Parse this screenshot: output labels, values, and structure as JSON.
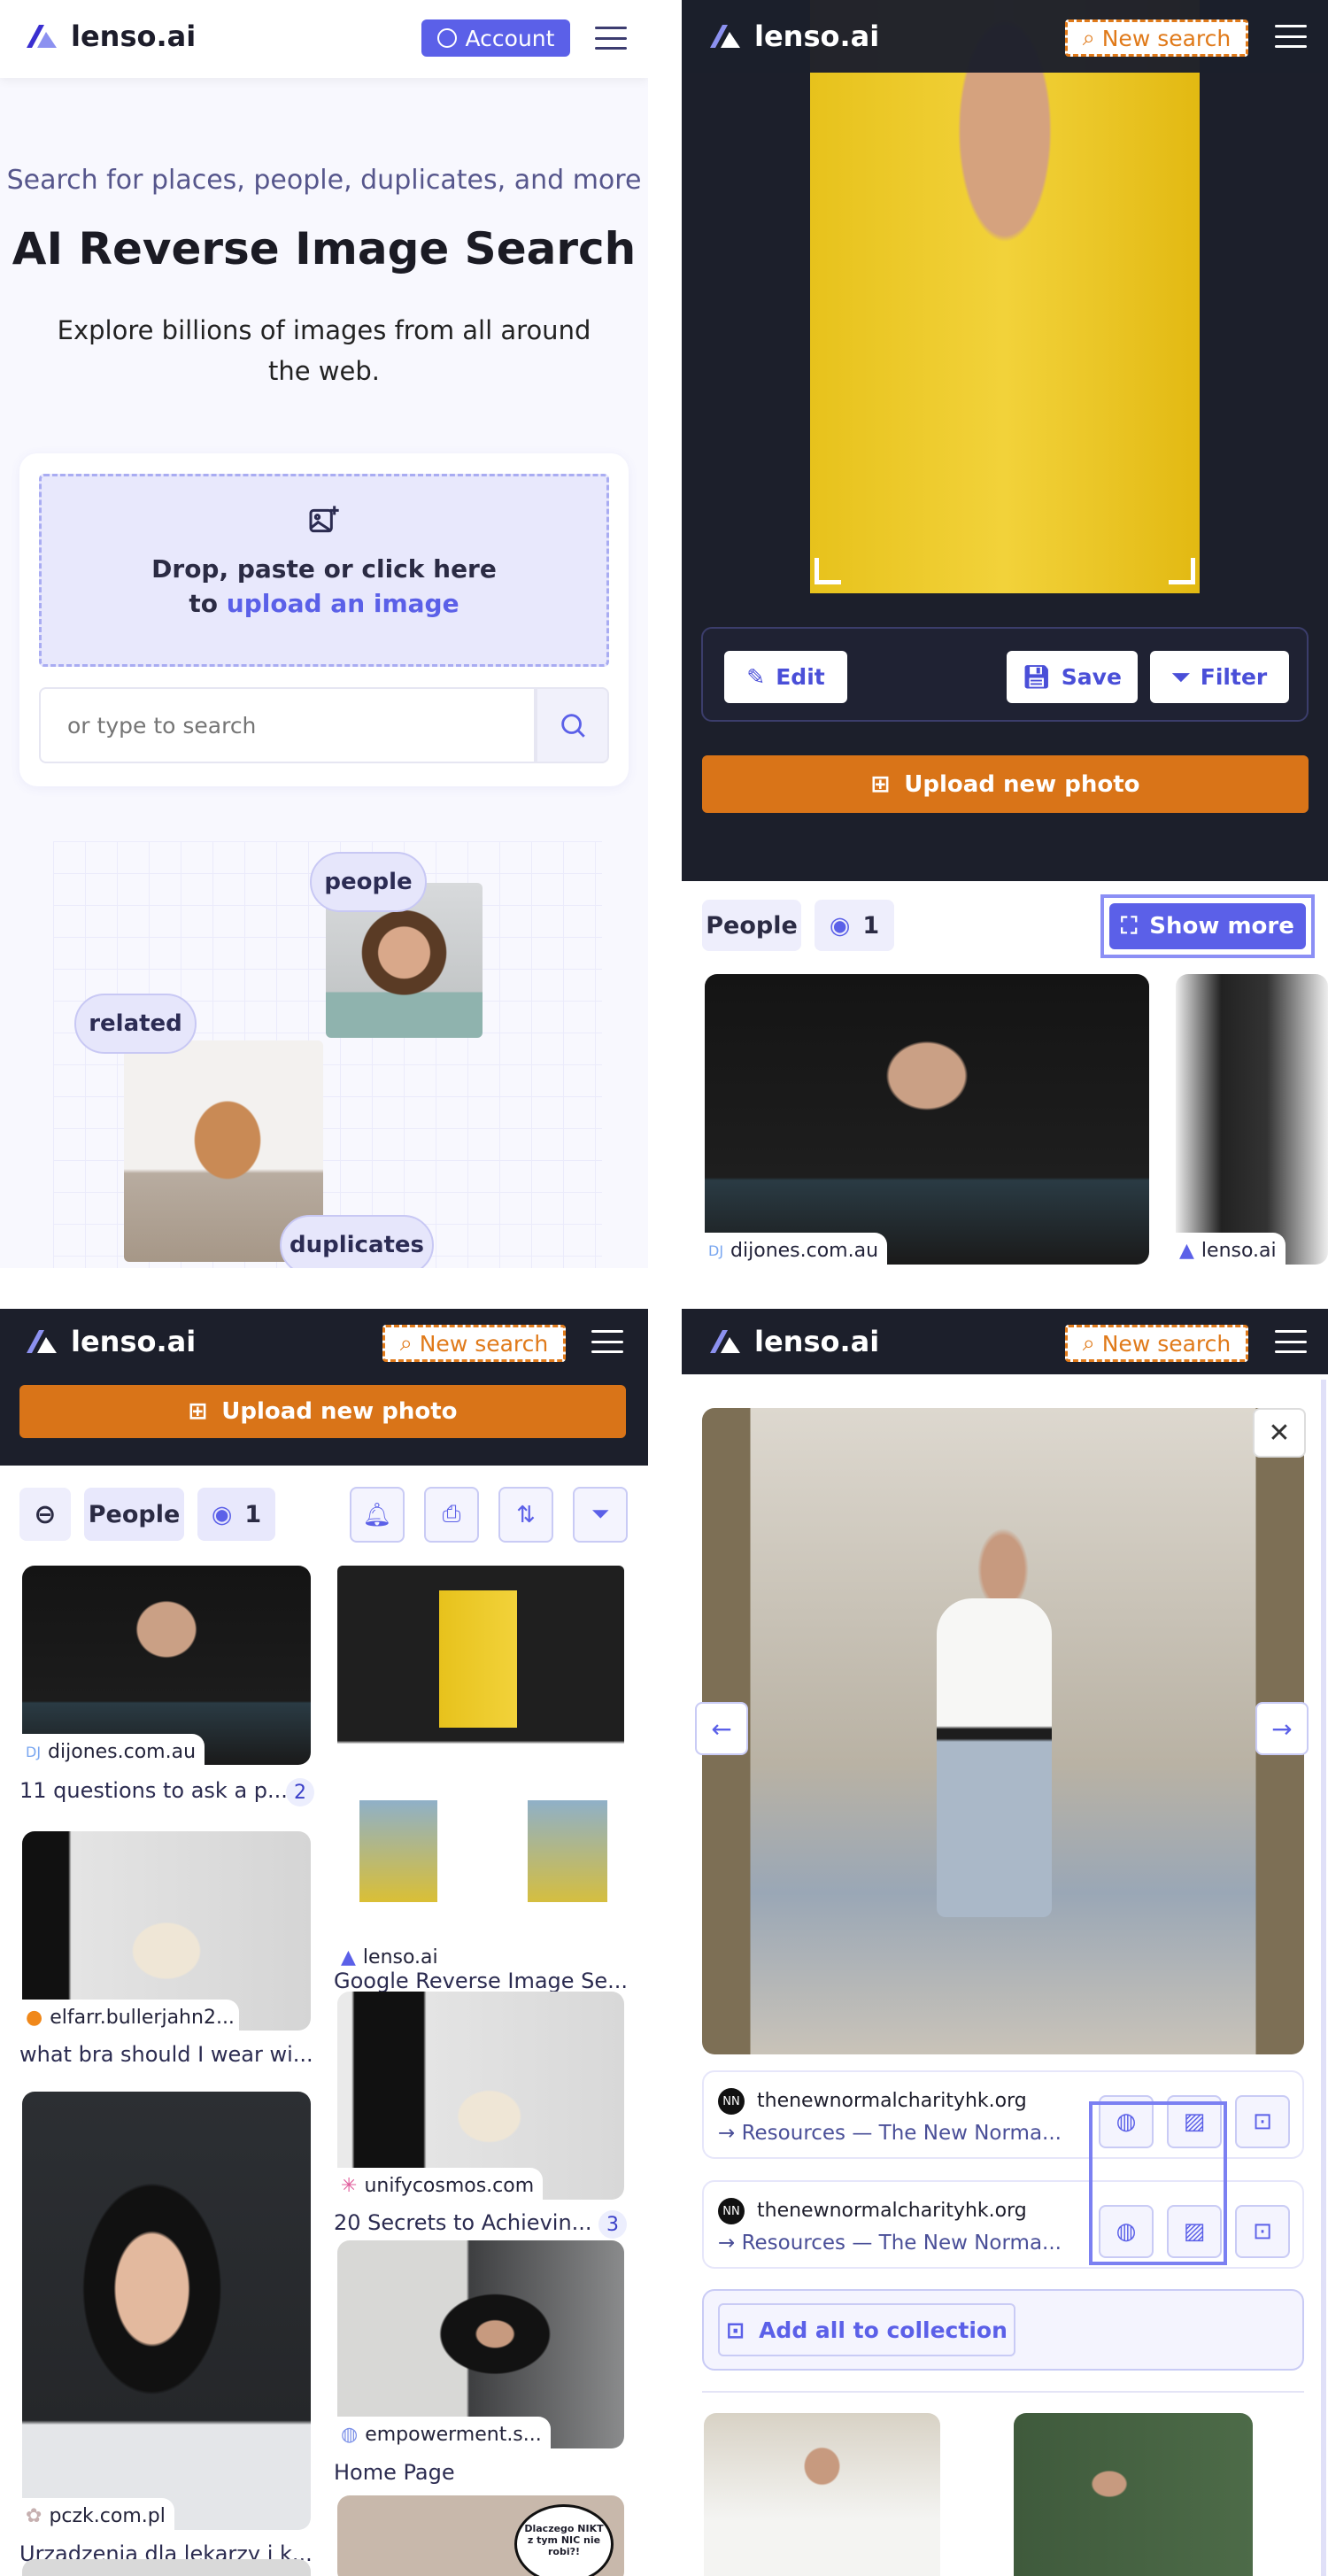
{
  "brand": {
    "name": "lenso.ai",
    "accent": "#5b60e8",
    "orange": "#d97418",
    "dark": "#1c1f2b"
  },
  "home": {
    "account_label": "Account",
    "tagline": "Search for places, people, duplicates, and more",
    "title": "AI Reverse Image Search",
    "subtitle": "Explore billions of images from all around the web.",
    "drop_line1": "Drop, paste or click here",
    "drop_prefix": "to",
    "drop_link": "upload an image",
    "search_placeholder": "or type to search",
    "tags": [
      "people",
      "related",
      "duplicates"
    ]
  },
  "search": {
    "new_search": "New search",
    "edit": "Edit",
    "save": "Save",
    "filter": "Filter",
    "upload_new": "Upload new photo",
    "category": "People",
    "views": "1",
    "show_more": "Show more",
    "preview_sources": [
      "dijones.com.au",
      "lenso.ai"
    ]
  },
  "results": {
    "category": "People",
    "views": "1",
    "upload_new": "Upload new photo",
    "left": [
      {
        "source": "dijones.com.au",
        "title": "11 questions to ask a p...",
        "count": "2"
      },
      {
        "source": "elfarr.bullerjahn2...",
        "title": "what bra should I wear wi..."
      },
      {
        "source": "pczk.com.pl",
        "title": "Urządzenia dla lekarzy i k..."
      }
    ],
    "right": [
      {
        "source": "lenso.ai",
        "title": "Google Reverse Image Se..."
      },
      {
        "source": "unifycosmos.com",
        "title": "20 Secrets to Achievin...",
        "count": "3"
      },
      {
        "source": "empowerment.s...",
        "title": "Home Page"
      }
    ],
    "ad_text": "Dlaczego NIKT z tym NIC nie robi?!"
  },
  "detail": {
    "new_search": "New search",
    "matches": [
      {
        "domain": "thenewnormalcharityhk.org",
        "title": "→ Resources — The New Norma..."
      },
      {
        "domain": "thenewnormalcharityhk.org",
        "title": "→ Resources — The New Norma..."
      }
    ],
    "add_all": "Add all to collection"
  }
}
